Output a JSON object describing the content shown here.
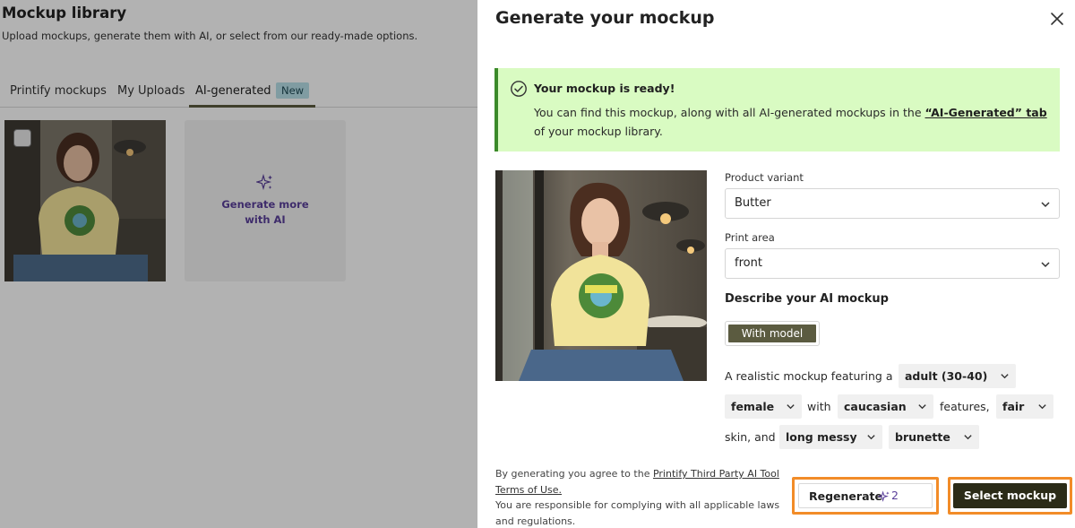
{
  "library": {
    "title": "Mockup library",
    "subtitle": "Upload mockups, generate them with AI, or select from our ready-made options.",
    "tabs": [
      {
        "label": "Printify mockups"
      },
      {
        "label": "My Uploads"
      },
      {
        "label": "AI-generated",
        "badge": "New",
        "active": true
      }
    ],
    "generate_card_label_line1": "Generate more",
    "generate_card_label_line2": "with AI"
  },
  "drawer": {
    "title": "Generate your mockup",
    "alert": {
      "title": "Your mockup is ready!",
      "body_before": "You can find this mockup, along with all AI-generated mockups in the ",
      "link": "“AI-Generated” tab",
      "body_after": " of your mockup library."
    },
    "product_variant": {
      "label": "Product variant",
      "value": "Butter"
    },
    "print_area": {
      "label": "Print area",
      "value": "front"
    },
    "describe_label": "Describe your AI mockup",
    "mode_chip": "With model",
    "sentence": {
      "t1": "A realistic mockup featuring a",
      "age": "adult (30-40)",
      "gender": "female",
      "t2": "with",
      "ethnicity": "caucasian",
      "t3": "features,",
      "skin": "fair",
      "t4": "skin, and",
      "hair_style": "long messy",
      "hair_color": "brunette"
    },
    "legal": {
      "before": "By generating you agree to the ",
      "link": "Printify Third Party AI Tool Terms of Use.",
      "after": "You are responsible for complying with all applicable laws and regulations."
    },
    "regenerate": {
      "label": "Regenerate",
      "credits": "2"
    },
    "select": {
      "label": "Select mockup"
    }
  },
  "colors": {
    "accent_olive": "#5b5b40",
    "success_bg": "#d9fbc2",
    "success_border": "#3b8a2a",
    "highlight_outline": "#f28c28",
    "ai_purple": "#5a3f9a",
    "primary_dark": "#2b2b17"
  },
  "icons": [
    "close-icon",
    "check-circle-icon",
    "sparkle-icon",
    "chevron-down-icon"
  ]
}
